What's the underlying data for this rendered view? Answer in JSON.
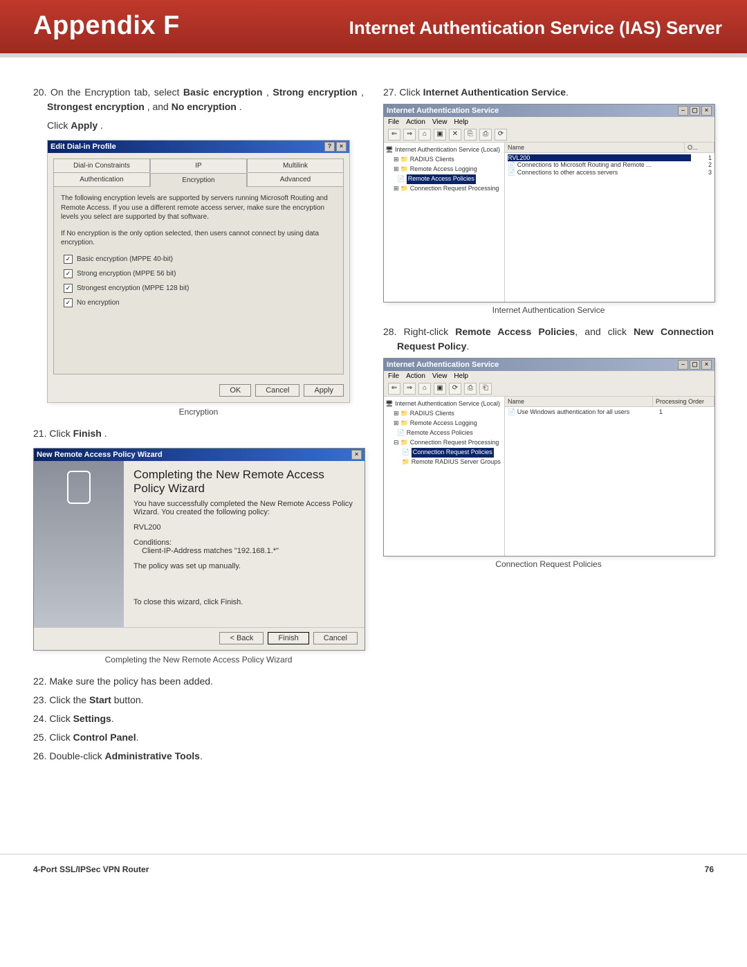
{
  "header": {
    "title": "Appendix F",
    "subtitle": "Internet Authentication Service (IAS) Server"
  },
  "left": {
    "s20_a": "On the Encryption tab, select ",
    "s20_b1": "Basic encryption",
    "s20_sep1": ", ",
    "s20_b2": "Strong encryption",
    "s20_sep2": ", ",
    "s20_b3": "Strongest encryption",
    "s20_sep3": ", and ",
    "s20_b4": "No encryption",
    "s20_end": ".",
    "s20_apply_a": "Click ",
    "s20_apply_b": "Apply",
    "s20_apply_end": ".",
    "dlg1": {
      "title": "Edit Dial-in Profile",
      "help": "?",
      "close": "×",
      "tabs": [
        "Dial-in Constraints",
        "IP",
        "Multilink",
        "Authentication",
        "Encryption",
        "Advanced"
      ],
      "note1": "The following encryption levels are supported by servers running Microsoft Routing and Remote Access. If you use a different remote access server, make sure the encryption levels you select are supported by that software.",
      "note2": "If No encryption is the only option selected, then users cannot connect by using data encryption.",
      "chk": [
        "Basic encryption (MPPE 40-bit)",
        "Strong encryption (MPPE 56 bit)",
        "Strongest encryption (MPPE 128 bit)",
        "No encryption"
      ],
      "buttons": [
        "OK",
        "Cancel",
        "Apply"
      ]
    },
    "cap1": "Encryption",
    "s21_a": "Click ",
    "s21_b": "Finish",
    "s21_end": ".",
    "wiz": {
      "title": "New Remote Access Policy Wizard",
      "close": "×",
      "heading": "Completing the New Remote Access Policy Wizard",
      "line1": "You have successfully completed the New Remote Access Policy Wizard. You created the following policy:",
      "policy": "RVL200",
      "cond_label": "Conditions:",
      "cond_value": "Client-IP-Address matches \"192.168.1.*\"",
      "manual": "The policy was set up manually.",
      "close_hint": "To close this wizard, click Finish.",
      "buttons": [
        "< Back",
        "Finish",
        "Cancel"
      ]
    },
    "cap2": "Completing the New Remote Access Policy Wizard",
    "s22": "Make sure the policy has been added.",
    "s23_a": "Click the ",
    "s23_b": "Start",
    "s23_end": " button.",
    "s24_a": "Click ",
    "s24_b": "Settings",
    "s24_end": ".",
    "s25_a": "Click ",
    "s25_b": "Control Panel",
    "s25_end": ".",
    "s26_a": "Double-click ",
    "s26_b": "Administrative Tools",
    "s26_end": "."
  },
  "right": {
    "s27_a": "Click ",
    "s27_b": "Internet Authentication Service",
    "s27_end": ".",
    "mmc1": {
      "title": "Internet Authentication Service",
      "menus": [
        "File",
        "Action",
        "View",
        "Help"
      ],
      "tbtn": [
        "⇐",
        "⇒",
        "⌂",
        "▣",
        "✕",
        "⎘",
        "⎙",
        "⟳"
      ],
      "tree": [
        {
          "t": "Internet Authentication Service (Local)",
          "lvl": 0
        },
        {
          "t": "RADIUS Clients",
          "lvl": 1
        },
        {
          "t": "Remote Access Logging",
          "lvl": 1
        },
        {
          "t": "Remote Access Policies",
          "lvl": 1,
          "sel": true
        },
        {
          "t": "Connection Request Processing",
          "lvl": 1
        }
      ],
      "cols": [
        "Name",
        "O..."
      ],
      "col2": "O...",
      "rows": [
        {
          "name": "RVL200",
          "order": "1",
          "sel": true
        },
        {
          "name": "Connections to Microsoft Routing and Remote ...",
          "order": "2"
        },
        {
          "name": "Connections to other access servers",
          "order": "3"
        }
      ]
    },
    "cap3": "Internet Authentication Service",
    "s28_a": "Right-click ",
    "s28_b": "Remote Access Policies",
    "s28_mid": ", and click ",
    "s28_c": "New Connection Request Policy",
    "s28_end": ".",
    "mmc2": {
      "title": "Internet Authentication Service",
      "menus": [
        "File",
        "Action",
        "View",
        "Help"
      ],
      "tbtn": [
        "⇐",
        "⇒",
        "⌂",
        "▣",
        "⟳",
        "⎙",
        "⎗"
      ],
      "tree": [
        {
          "t": "Internet Authentication Service (Local)",
          "lvl": 0
        },
        {
          "t": "RADIUS Clients",
          "lvl": 1
        },
        {
          "t": "Remote Access Logging",
          "lvl": 1
        },
        {
          "t": "Remote Access Policies",
          "lvl": 1
        },
        {
          "t": "Connection Request Processing",
          "lvl": 1
        },
        {
          "t": "Connection Request Policies",
          "lvl": 2,
          "sel": true
        },
        {
          "t": "Remote RADIUS Server Groups",
          "lvl": 2
        }
      ],
      "cols": [
        "Name",
        "Processing Order"
      ],
      "rows": [
        {
          "name": "Use Windows authentication for all users",
          "order": "1"
        }
      ]
    },
    "cap4": "Connection Request Policies"
  },
  "footer": {
    "product": "4-Port SSL/IPSec VPN Router",
    "page": "76"
  }
}
